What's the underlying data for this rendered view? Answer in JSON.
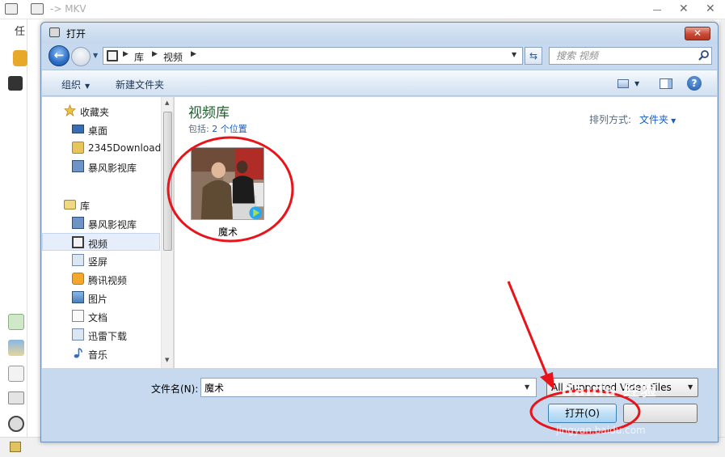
{
  "background_window": {
    "title": "-> MKV",
    "left_label": "任"
  },
  "dialog": {
    "title": "打开",
    "address": {
      "crumbs": [
        "库",
        "视频"
      ]
    },
    "search": {
      "placeholder": "搜索 视频"
    },
    "toolbar": {
      "organize": "组织",
      "new_folder": "新建文件夹"
    },
    "nav": {
      "favorites": "收藏夹",
      "fav_items": [
        "桌面",
        "2345Download",
        "暴风影视库"
      ],
      "libraries": "库",
      "lib_items": [
        "暴风影视库",
        "视频",
        "竖屏",
        "腾讯视频",
        "图片",
        "文档",
        "迅雷下载",
        "音乐"
      ],
      "selected": "视频"
    },
    "content": {
      "library_title": "视频库",
      "includes_label": "包括:",
      "includes_link": "2 个位置",
      "arrange_label": "排列方式:",
      "arrange_value": "文件夹",
      "files": [
        {
          "name": "魔术"
        }
      ]
    },
    "footer": {
      "filename_label": "文件名(N):",
      "filename_value": "魔术",
      "filetype_value": "All Supported Video Files",
      "open_button": "打开(O)"
    }
  },
  "watermark": {
    "text": "Baidu 经验",
    "subtext": "jingyan.baidu.com"
  },
  "colors": {
    "annotation_red": "#e8141a",
    "library_title_green": "#1e5e2d",
    "link_blue": "#1a5dbf"
  }
}
